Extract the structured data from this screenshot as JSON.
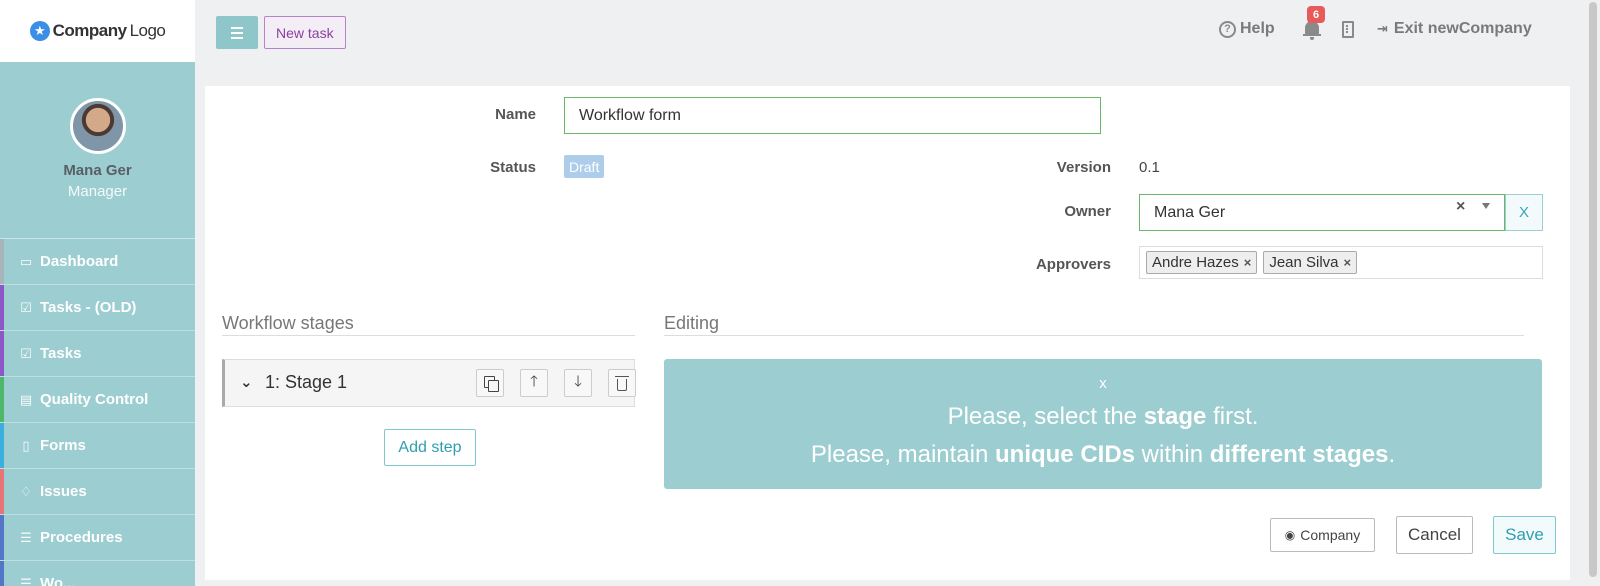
{
  "logo": {
    "prefix": "Company",
    "suffix": "Logo",
    "icon": "star-icon"
  },
  "profile": {
    "name": "Mana Ger",
    "role": "Manager"
  },
  "sidebar": {
    "items": [
      {
        "label": "Dashboard",
        "icon": "monitor-icon"
      },
      {
        "label": "Tasks - (OLD)",
        "icon": "check-square-icon"
      },
      {
        "label": "Tasks",
        "icon": "check-square-icon"
      },
      {
        "label": "Quality Control",
        "icon": "book-icon"
      },
      {
        "label": "Forms",
        "icon": "file-icon"
      },
      {
        "label": "Issues",
        "icon": "bell-outline-icon"
      },
      {
        "label": "Procedures",
        "icon": "list-icon"
      },
      {
        "label": "Wo...",
        "icon": "list-icon"
      }
    ],
    "accent_colors": [
      "#a7b4ba",
      "#8e57c8",
      "#8e57c8",
      "#4db86a",
      "#3bb0e0",
      "#e77575",
      "#5476c9",
      "#5476c9"
    ]
  },
  "topbar": {
    "new_task_label": "New task",
    "help_label": "Help",
    "notifications_count": "6",
    "exit_label": "Exit newCompany"
  },
  "form": {
    "name_label": "Name",
    "name_value": "Workflow form",
    "status_label": "Status",
    "status_value": "Draft",
    "version_label": "Version",
    "version_value": "0.1",
    "owner_label": "Owner",
    "owner_value": "Mana Ger",
    "owner_clear": "×",
    "owner_x_button": "X",
    "approvers_label": "Approvers",
    "approvers": [
      "Andre Hazes",
      "Jean Silva"
    ],
    "tag_remove": "×"
  },
  "stages": {
    "title": "Workflow stages",
    "items": [
      {
        "label": "1: Stage 1"
      }
    ],
    "add_step_label": "Add step"
  },
  "editing": {
    "title": "Editing",
    "alert_close": "x",
    "line1": {
      "pre": "Please, select the ",
      "bold": "stage",
      "post": " first."
    },
    "line2": {
      "pre": "Please, maintain ",
      "bold1": "unique CIDs",
      "mid": " within ",
      "bold2": "different stages",
      "post": "."
    }
  },
  "actions": {
    "company_label": "Company",
    "cancel_label": "Cancel",
    "save_label": "Save"
  },
  "colors": {
    "accent": "#9ccdd0",
    "valid_border": "#6ab76a",
    "badge_red": "#e85a5a",
    "status_blue": "#aecdea",
    "new_task_purple": "#8b3fa0"
  }
}
